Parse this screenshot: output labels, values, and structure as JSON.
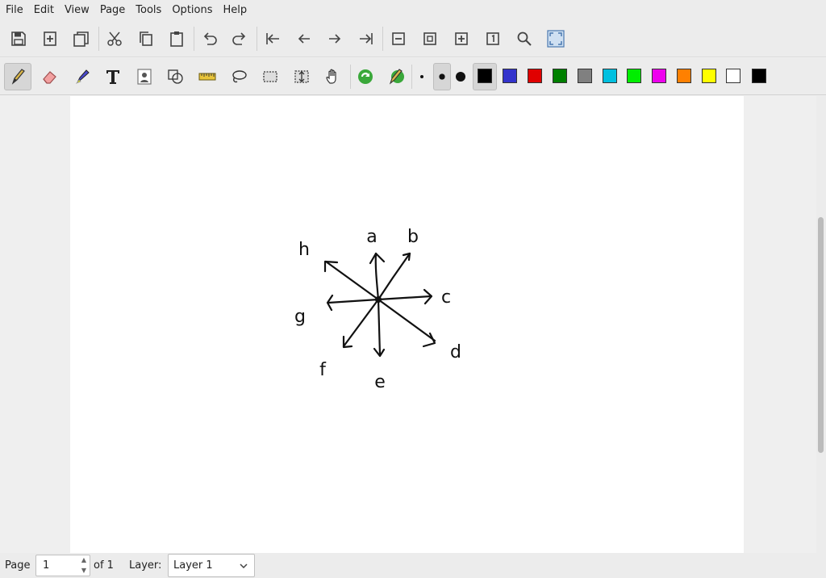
{
  "menu": [
    "File",
    "Edit",
    "View",
    "Page",
    "Tools",
    "Options",
    "Help"
  ],
  "toolbar1": [
    "save",
    "new-page",
    "duplicate-page",
    "cut",
    "copy",
    "paste",
    "undo",
    "redo",
    "first-page",
    "previous-page",
    "next-page",
    "last-page",
    "zoom-out",
    "zoom-fit",
    "zoom-in",
    "zoom-100",
    "zoom-search",
    "fullscreen"
  ],
  "toolbar2": {
    "tools": [
      "pen",
      "eraser",
      "highlighter",
      "text",
      "image",
      "shape",
      "ruler",
      "lasso-select",
      "rect-select",
      "vertical-space",
      "hand",
      "shape-recognizer",
      "default-tool"
    ],
    "thickness": [
      "fine",
      "medium",
      "thick"
    ],
    "active_tool": "pen",
    "active_thickness": "medium",
    "colors": [
      "#000000",
      "#3333cc",
      "#e00000",
      "#008000",
      "#808080",
      "#00c0e0",
      "#00ee00",
      "#ee00ee",
      "#ff8000",
      "#ffff00",
      "#ffffff",
      "#000000"
    ],
    "active_color": "#000000"
  },
  "drawing": {
    "labels": [
      "a",
      "b",
      "c",
      "d",
      "e",
      "f",
      "g",
      "h"
    ]
  },
  "status": {
    "page_label": "Page",
    "page_value": "1",
    "of_label": "of 1",
    "layer_label": "Layer:",
    "layer_value": "Layer 1"
  }
}
